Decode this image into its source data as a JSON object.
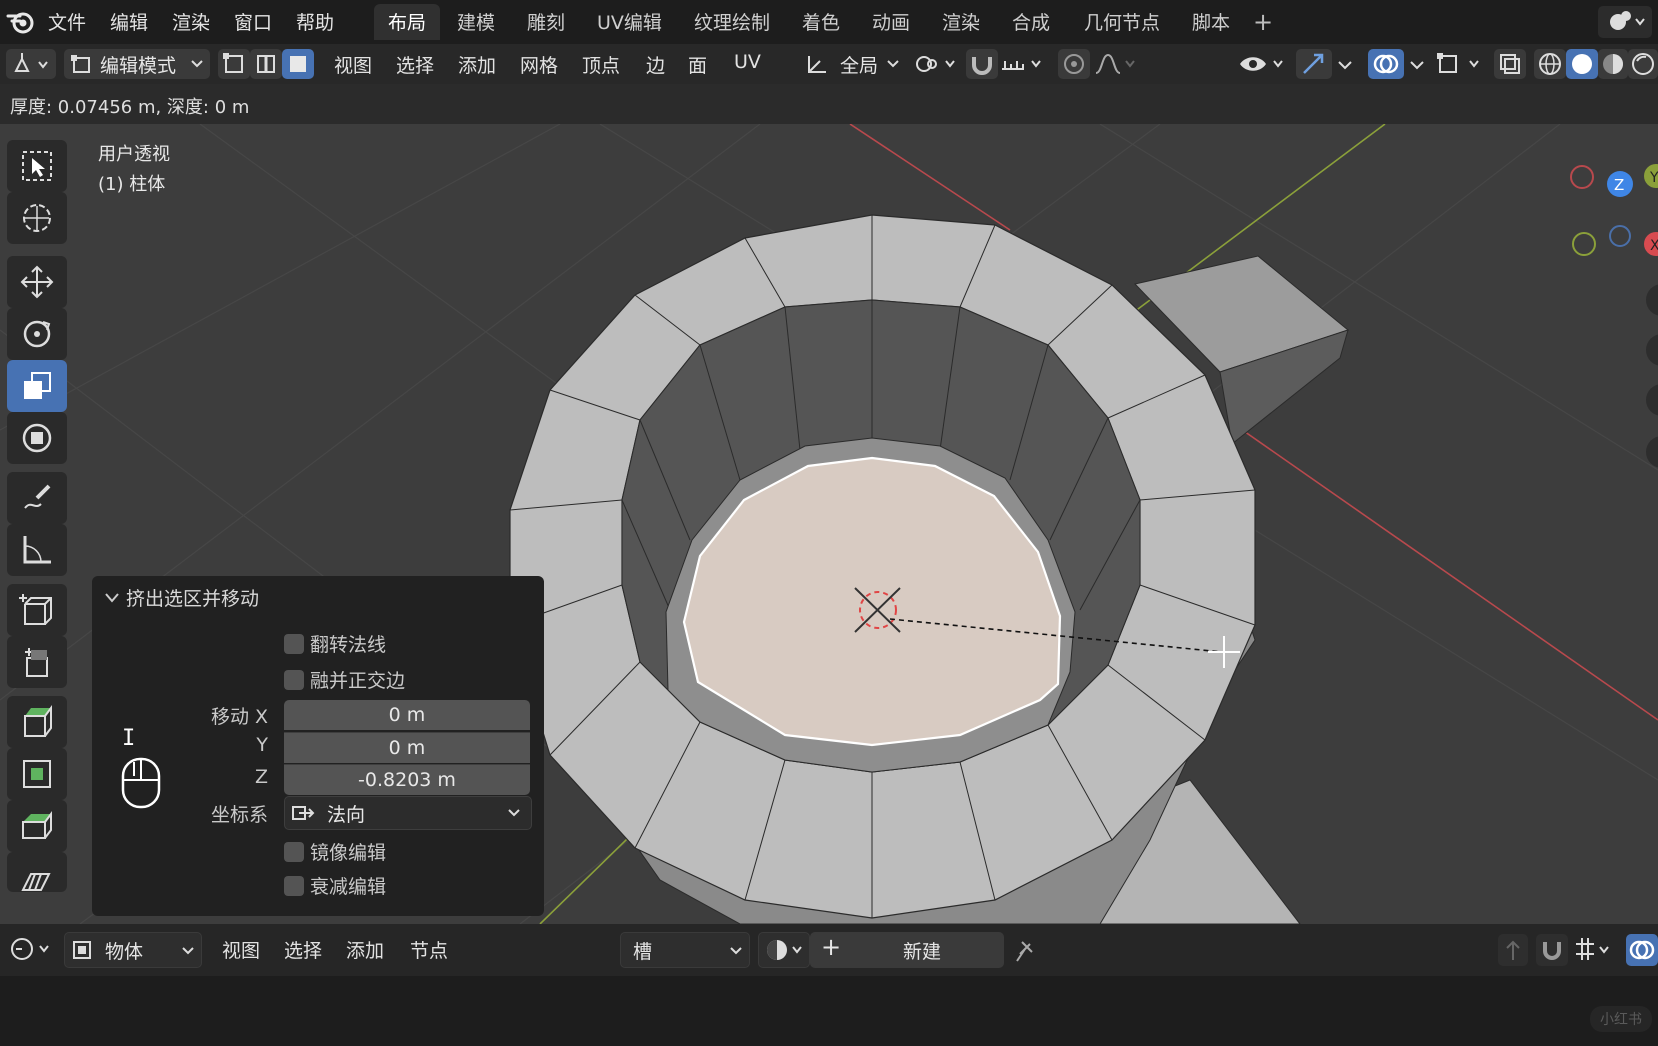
{
  "menubar": {
    "items": [
      "文件",
      "编辑",
      "渲染",
      "窗口",
      "帮助"
    ]
  },
  "workspaces": {
    "tabs": [
      "布局",
      "建模",
      "雕刻",
      "UV编辑",
      "纹理绘制",
      "着色",
      "动画",
      "渲染",
      "合成",
      "几何节点",
      "脚本"
    ],
    "active": "布局",
    "add_icon": "plus-icon"
  },
  "header": {
    "mode_label": "编辑模式",
    "menus": [
      "视图",
      "选择",
      "添加",
      "网格",
      "顶点",
      "边",
      "面",
      "UV"
    ],
    "orientation_label": "全局"
  },
  "status": {
    "text": "厚度: 0.07456 m, 深度: 0 m"
  },
  "viewport": {
    "view_name": "用户透视",
    "object_label": "(1) 柱体",
    "gizmo": {
      "z_label": "Z",
      "y_label": "Y",
      "x_label": "X"
    },
    "colors": {
      "background": "#3d3d3d",
      "selection_face": "#d8cbc2",
      "x_axis": "#b8494d",
      "y_axis": "#8ba03a",
      "active_tool": "#4772b3"
    }
  },
  "operator_panel": {
    "title": "挤出选区并移动",
    "flip_normals_label": "翻转法线",
    "dissolve_label": "融并正交边",
    "move_label": "移动 X",
    "move_y_label": "Y",
    "move_z_label": "Z",
    "move_x_value": "0 m",
    "move_y_value": "0 m",
    "move_z_value": "-0.8203 m",
    "orientation_label": "坐标系",
    "orientation_value": "法向",
    "mirror_label": "镜像编辑",
    "falloff_label": "衰减编辑",
    "text_cursor_glyph": "I"
  },
  "bottom_header": {
    "object_mode": "物体",
    "menus": [
      "视图",
      "选择",
      "添加",
      "节点"
    ],
    "slot_label": "槽",
    "new_label": "新建",
    "watermark": "小红书"
  }
}
